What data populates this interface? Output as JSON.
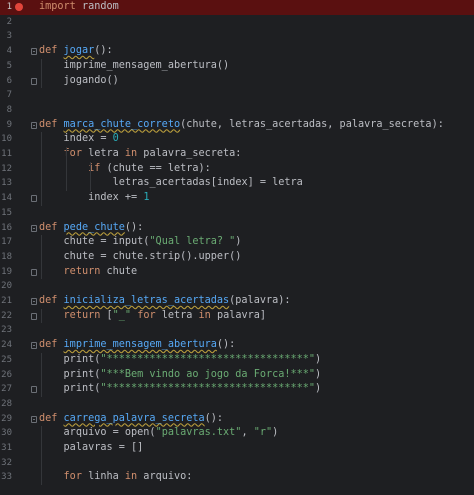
{
  "editor": {
    "line_numbers": [
      "1",
      "2",
      "3",
      "4",
      "5",
      "6",
      "7",
      "8",
      "9",
      "10",
      "11",
      "12",
      "13",
      "14",
      "15",
      "16",
      "17",
      "18",
      "19",
      "20",
      "21",
      "22",
      "23",
      "24",
      "25",
      "26",
      "27",
      "28",
      "29",
      "30",
      "31",
      "32",
      "33"
    ],
    "colors": {
      "background": "#1e1f22",
      "highlight_line": "#5a1010",
      "breakpoint": "#e2453b",
      "keyword": "#cf8e6d",
      "function": "#56a8f5",
      "number": "#2aacb8",
      "string": "#6aab73",
      "text": "#bcbec4"
    },
    "lines": [
      [
        "import",
        " random"
      ],
      [],
      [],
      [
        "def",
        " ",
        "jogar",
        "():"
      ],
      [
        "imprime_mensagem_abertura()"
      ],
      [
        "jogando()"
      ],
      [],
      [],
      [
        "def",
        " ",
        "marca_chute_correto",
        "(chute, letras_acertadas, palavra_secreta):"
      ],
      [
        "index = ",
        "0"
      ],
      [
        "for",
        " letra ",
        "in",
        " palavra_secreta:"
      ],
      [
        "if",
        " (chute == letra):"
      ],
      [
        "letras_acertadas[index] = letra"
      ],
      [
        "index += ",
        "1"
      ],
      [],
      [
        "def",
        " ",
        "pede_chute",
        "():"
      ],
      [
        "chute = input(",
        "\"Qual letra? \"",
        ")"
      ],
      [
        "chute = chute.strip().upper()"
      ],
      [
        "return",
        " chute"
      ],
      [],
      [
        "def",
        " ",
        "inicializa_letras_acertadas",
        "(palavra):"
      ],
      [
        "return",
        " [",
        "\"_\"",
        " ",
        "for",
        " letra ",
        "in",
        " palavra]"
      ],
      [],
      [
        "def",
        " ",
        "imprime_mensagem_abertura",
        "():"
      ],
      [
        "print(",
        "\"*********************************\"",
        ")"
      ],
      [
        "print(",
        "\"***Bem vindo ao jogo da Forca!***\"",
        ")"
      ],
      [
        "print(",
        "\"*********************************\"",
        ")"
      ],
      [],
      [
        "def",
        " ",
        "carrega_palavra_secreta",
        "():"
      ],
      [
        "arquivo = open(",
        "\"palavras.txt\"",
        ", ",
        "\"r\"",
        ")"
      ],
      [
        "palavras = []"
      ],
      [],
      [
        "for",
        " linha ",
        "in",
        " arquivo:"
      ]
    ]
  }
}
